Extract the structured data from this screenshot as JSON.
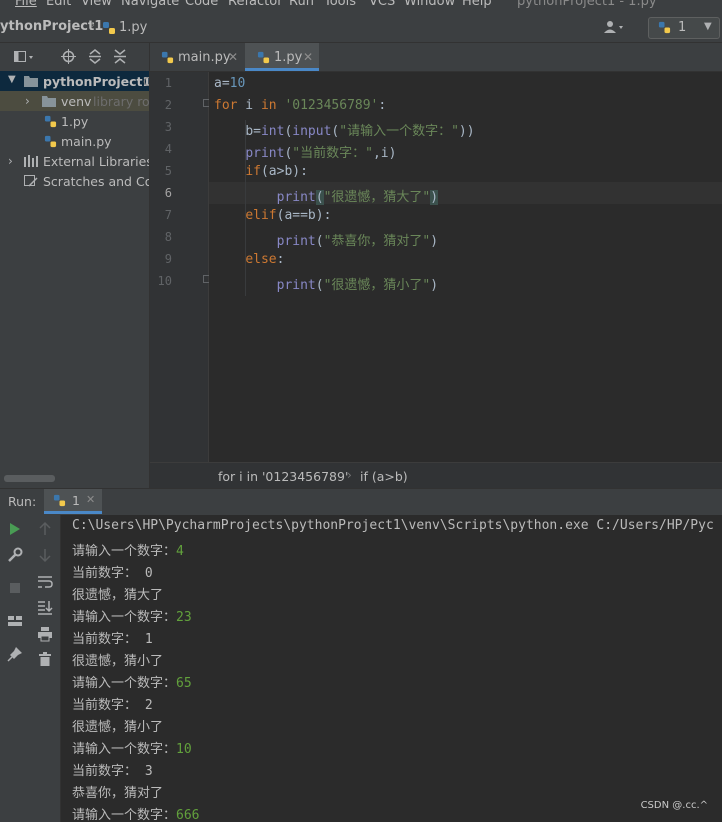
{
  "menu": [
    "File",
    "Edit",
    "View",
    "Navigate",
    "Code",
    "Refactor",
    "Run",
    "Tools",
    "VCS",
    "Window",
    "Help"
  ],
  "window_title": "pythonProject1 - 1.py",
  "nav": {
    "project": "ythonProject1",
    "file": "1.py",
    "run_config": "1"
  },
  "sidebar": {
    "project_root": "pythonProject1",
    "root_suffix": "C",
    "venv": "venv",
    "venv_hint": "library roo",
    "files": [
      "1.py",
      "main.py"
    ],
    "external": "External Libraries",
    "scratches": "Scratches and Cor"
  },
  "tabs": [
    {
      "label": "main.py",
      "active": false
    },
    {
      "label": "1.py",
      "active": true
    }
  ],
  "code_lines": [
    "1",
    "2",
    "3",
    "4",
    "5",
    "6",
    "7",
    "8",
    "9",
    "10"
  ],
  "code": {
    "l1a": "a=",
    "l1b": "10",
    "l2kw": "for",
    "l2a": " i ",
    "l2in": "in",
    "l2sp": " ",
    "l2str": "'0123456789'",
    "l2c": ":",
    "l3a": "b=",
    "l3int": "int",
    "l3b": "(",
    "l3inp": "input",
    "l3c": "(",
    "l3str": "\"请输入一个数字：\"",
    "l3d": "))",
    "l4p": "print",
    "l4a": "(",
    "l4str": "\"当前数字：\"",
    "l4b": ",i)",
    "l5kw": "if",
    "l5a": "(a>b):",
    "l6p": "print",
    "l6a": "(",
    "l6str": "\"很遗憾，猜大了\"",
    "l6b": ")",
    "l7kw": "elif",
    "l7a": "(a==b):",
    "l8p": "print",
    "l8a": "(",
    "l8str": "\"恭喜你，猜对了\"",
    "l8b": ")",
    "l9kw": "else",
    "l9a": ":",
    "l10p": "print",
    "l10a": "(",
    "l10str": "\"很遗憾，猜小了\"",
    "l10b": ")"
  },
  "breadcrumb": {
    "item1": "for i in '0123456789'",
    "sep": "›",
    "item2": "if (a>b)"
  },
  "run": {
    "label": "Run:",
    "tab": "1"
  },
  "console": {
    "cmd": "C:\\Users\\HP\\PycharmProjects\\pythonProject1\\venv\\Scripts\\python.exe C:/Users/HP/Pyc",
    "lines": [
      {
        "t": "请输入一个数字：",
        "in": "4"
      },
      {
        "t": "当前数字： 0",
        "in": ""
      },
      {
        "t": "很遗憾，猜大了",
        "in": ""
      },
      {
        "t": "请输入一个数字：",
        "in": "23"
      },
      {
        "t": "当前数字： 1",
        "in": ""
      },
      {
        "t": "很遗憾，猜小了",
        "in": ""
      },
      {
        "t": "请输入一个数字：",
        "in": "65"
      },
      {
        "t": "当前数字： 2",
        "in": ""
      },
      {
        "t": "很遗憾，猜小了",
        "in": ""
      },
      {
        "t": "请输入一个数字：",
        "in": "10"
      },
      {
        "t": "当前数字： 3",
        "in": ""
      },
      {
        "t": "恭喜你，猜对了",
        "in": ""
      },
      {
        "t": "请输入一个数字：",
        "in": "666"
      }
    ]
  },
  "watermark": "CSDN @.cc.^",
  "colors": {
    "keyword": "#cc7832",
    "string": "#6a8759",
    "number": "#6897bb",
    "builtin": "#8888c6",
    "input": "#62a13c"
  }
}
